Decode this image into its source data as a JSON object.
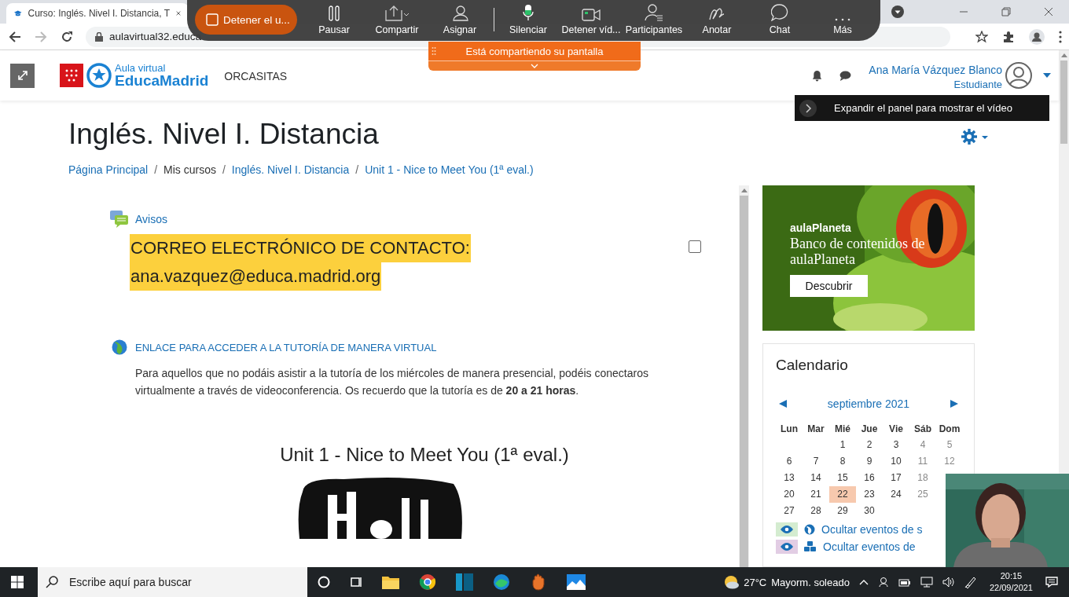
{
  "browser": {
    "tabs": [
      {
        "title": "Curso: Inglés. Nivel I. Distancia, T",
        "selected": true
      }
    ],
    "url": "aulavirtual32.educa"
  },
  "zoom_toolbar": {
    "stop_button": "Detener el u...",
    "items": [
      {
        "label": "Pausar",
        "kind": "pause"
      },
      {
        "label": "Compartir",
        "kind": "share"
      },
      {
        "label": "Asignar",
        "kind": "assign"
      },
      {
        "label": "Silenciar",
        "kind": "mic"
      },
      {
        "label": "Detener víd...",
        "kind": "video"
      },
      {
        "label": "Participantes",
        "kind": "participants"
      },
      {
        "label": "Anotar",
        "kind": "annotate"
      },
      {
        "label": "Chat",
        "kind": "chat"
      },
      {
        "label": "Más",
        "kind": "more"
      }
    ],
    "banner": "Está compartiendo su pantalla"
  },
  "header": {
    "logo_top": "Aula virtual",
    "logo_bottom": "EducaMadrid",
    "site": "ORCASITAS",
    "user": "Ana María Vázquez Blanco",
    "role": "Estudiante",
    "tooltip": "Expandir el panel para mostrar el vídeo"
  },
  "page": {
    "title": "Inglés. Nivel I. Distancia",
    "separator": "/",
    "breadcrumb": [
      {
        "label": "Página Principal",
        "link": true
      },
      {
        "label": "Mis cursos",
        "link": false
      },
      {
        "label": "Inglés. Nivel I. Distancia",
        "link": true
      },
      {
        "label": "Unit 1 - Nice to Meet You (1ª eval.)",
        "link": true
      }
    ]
  },
  "content": {
    "forum": "Avisos",
    "notice": [
      "CORREO ELECTRÓNICO DE CONTACTO:",
      "ana.vazquez@educa.madrid.org"
    ],
    "checked": false,
    "link": "ENLACE PARA ACCEDER A LA TUTORÍA DE MANERA VIRTUAL",
    "description": "Para aquellos que no podáis asistir a la tutoría de los miércoles de manera presencial, podéis conectaros virtualmente a través de videoconferencia. Os recuerdo que la tutoría es de **20 a 21 horas**.",
    "section_title": "Unit 1 - Nice to Meet You (1ª eval.)"
  },
  "ad": {
    "brand": "aulaPlaneta",
    "headline": "Banco de contenidos de aulaPlaneta",
    "button": "Descubrir"
  },
  "calendar": {
    "title": "Calendario",
    "month": "septiembre 2021",
    "weekdays": [
      "Lun",
      "Mar",
      "Mié",
      "Jue",
      "Vie",
      "Sáb",
      "Dom"
    ],
    "weeks": [
      {
        "kind": "start",
        "days": [
          {
            "d": "1",
            "today": false
          },
          {
            "d": "2",
            "today": false
          },
          {
            "d": "3",
            "today": false
          },
          {
            "d": "4",
            "today": false
          },
          {
            "d": "5",
            "today": false
          }
        ]
      },
      {
        "kind": "full",
        "days": [
          {
            "d": "6",
            "today": false
          },
          {
            "d": "7",
            "today": false
          },
          {
            "d": "8",
            "today": false
          },
          {
            "d": "9",
            "today": false
          },
          {
            "d": "10",
            "today": false
          },
          {
            "d": "11",
            "today": false
          },
          {
            "d": "12",
            "today": false
          }
        ]
      },
      {
        "kind": "full",
        "days": [
          {
            "d": "13",
            "today": false
          },
          {
            "d": "14",
            "today": false
          },
          {
            "d": "15",
            "today": false
          },
          {
            "d": "16",
            "today": false
          },
          {
            "d": "17",
            "today": false
          },
          {
            "d": "18",
            "today": false
          }
        ]
      },
      {
        "kind": "full",
        "days": [
          {
            "d": "20",
            "today": false
          },
          {
            "d": "21",
            "today": false
          },
          {
            "d": "22",
            "today": true
          },
          {
            "d": "23",
            "today": false
          },
          {
            "d": "24",
            "today": false
          },
          {
            "d": "25",
            "today": false
          }
        ]
      },
      {
        "kind": "full",
        "days": [
          {
            "d": "27",
            "today": false
          },
          {
            "d": "28",
            "today": false
          },
          {
            "d": "29",
            "today": false
          },
          {
            "d": "30",
            "today": false
          }
        ]
      }
    ],
    "filters": [
      {
        "label": "Ocultar eventos de s",
        "kind": "site",
        "color": "#d4ecd0"
      },
      {
        "label": "Ocultar eventos de",
        "kind": "category",
        "color": "#e2cde4"
      }
    ]
  },
  "taskbar": {
    "search": "Escribe aquí para buscar",
    "weather": "27°C",
    "forecast": "Mayorm. soleado",
    "time": "20:15",
    "date": "22/09/2021"
  }
}
